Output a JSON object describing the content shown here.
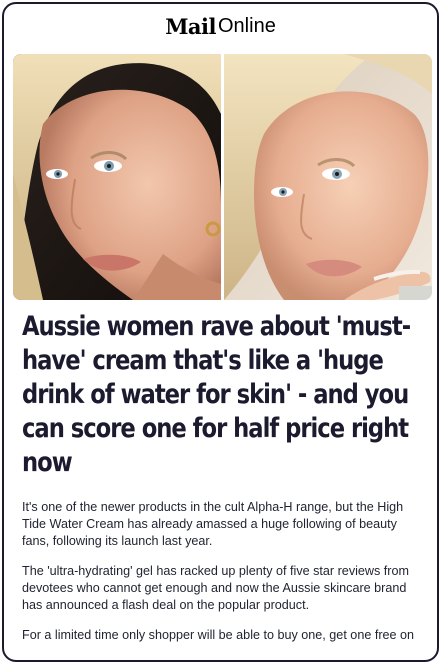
{
  "masthead": {
    "brand_bold": "Mail",
    "brand_light": "Online"
  },
  "images": [
    {
      "icon": "woman-selfie-photo",
      "alt_colors": {
        "skin": "#e7b59a",
        "hair": "#e4d0a4",
        "background": "#1b1613"
      }
    },
    {
      "icon": "woman-glowing-skin-photo",
      "alt_colors": {
        "skin": "#edbfa0",
        "hair": "#e6d5aa",
        "background": "#eadfd0"
      }
    }
  ],
  "article": {
    "headline": "Aussie women rave about 'must-have' cream that's like a 'huge drink of water for skin' - and you can score one for half price right now",
    "paragraphs": [
      "It's one of the newer products in the cult Alpha-H range, but the High Tide Water Cream has already amassed a huge following of beauty fans, following its launch last year.",
      "The 'ultra-hydrating' gel has racked up plenty of five star reviews from devotees who cannot get enough and now the Aussie skincare brand has announced a flash deal on the popular product.",
      "For a limited time only shopper will be able to buy one, get one free on"
    ]
  },
  "colors": {
    "frame": "#1a1a2e",
    "headline": "#1c1a2e",
    "text": "#1f2230"
  }
}
